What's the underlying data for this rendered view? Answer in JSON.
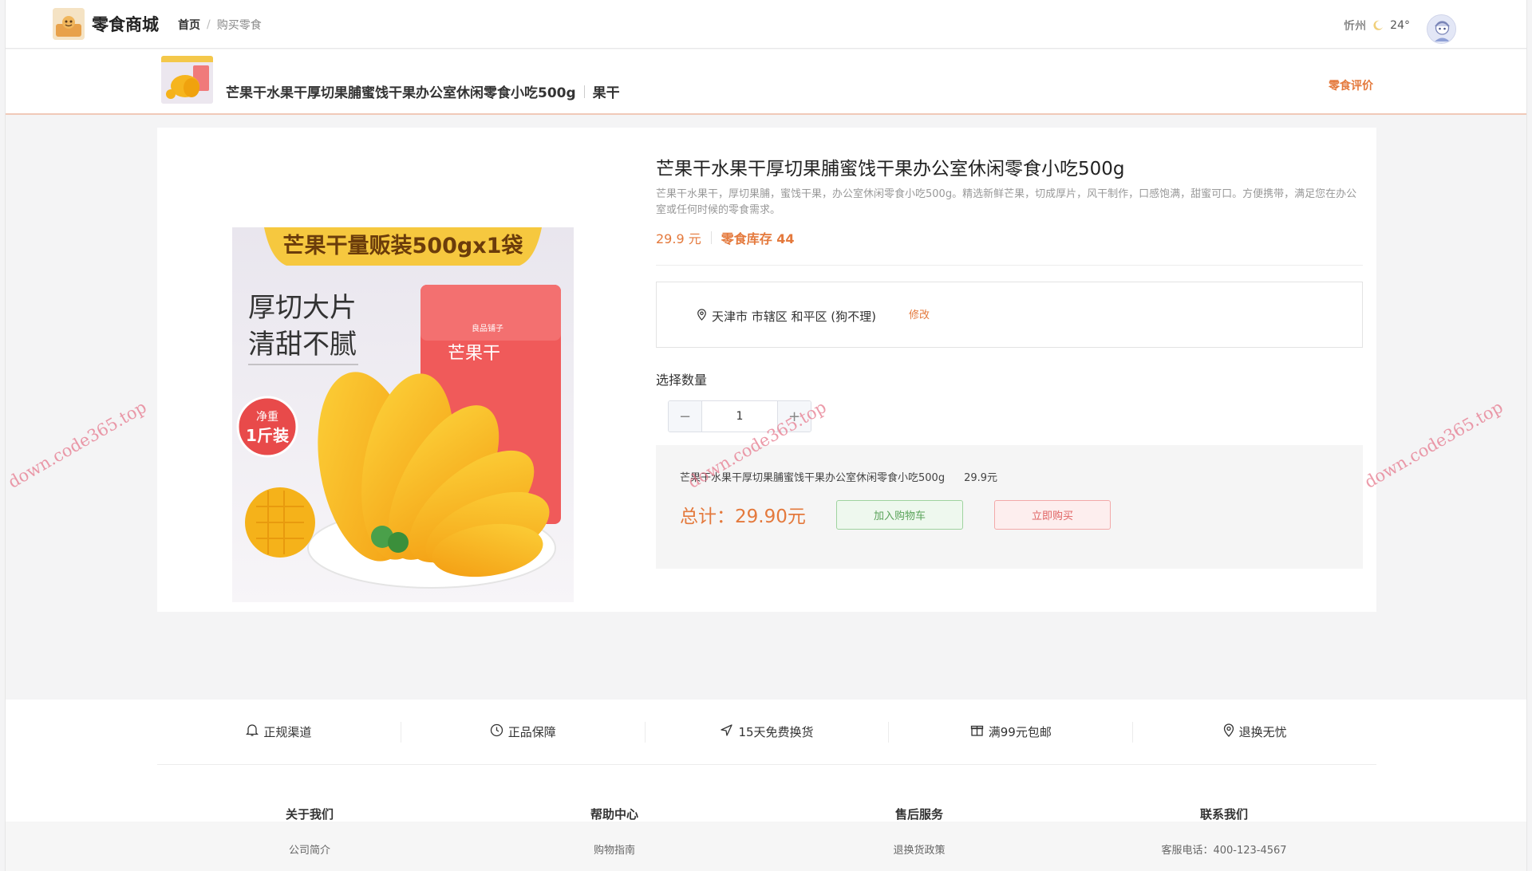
{
  "header": {
    "brand": "零食商城",
    "breadcrumb": [
      "首页",
      "/",
      "购买零食"
    ],
    "city": "忻州",
    "temperature": "24°"
  },
  "product_bar": {
    "title": "芒果干水果干厚切果脯蜜饯干果办公室休闲零食小吃500g",
    "category": "果干",
    "review_link": "零食评价",
    "thumb_banner": "芒果干量贩装500gx1袋"
  },
  "product": {
    "title": "芒果干水果干厚切果脯蜜饯干果办公室休闲零食小吃500g",
    "description": "芒果干水果干，厚切果脯，蜜饯干果，办公室休闲零食小吃500g。精选新鲜芒果，切成厚片，风干制作，口感饱满，甜蜜可口。方便携带，满足您在办公室或任何时候的零食需求。",
    "price": "29.9 元",
    "stock": "零食库存 44",
    "image_text": {
      "banner": "芒果干量贩装500gx1袋",
      "slogan1": "厚切大片",
      "slogan2": "清甜不腻",
      "badge1": "净重",
      "badge2": "1斤装",
      "pack_brand": "良品铺子",
      "pack_name": "芒果干"
    }
  },
  "address": {
    "text": "天津市 市辖区 和平区 (狗不理)",
    "modify": "修改"
  },
  "quantity": {
    "label": "选择数量",
    "value": "1",
    "minus": "−",
    "plus": "+"
  },
  "summary": {
    "item_name": "芒果干水果干厚切果脯蜜饯干果办公室休闲零食小吃500g",
    "item_price": "29.9元",
    "total": "总计：29.90元",
    "add_to_cart": "加入购物车",
    "buy_now": "立即购买"
  },
  "guarantees": [
    "正规渠道",
    "正品保障",
    "15天免费换货",
    "满99元包邮",
    "退换无忧"
  ],
  "footer_columns": [
    {
      "heading": "关于我们",
      "link": "公司简介"
    },
    {
      "heading": "帮助中心",
      "link": "购物指南"
    },
    {
      "heading": "售后服务",
      "link": "退换货政策"
    },
    {
      "heading": "联系我们",
      "link": "客服电话：400-123-4567"
    }
  ],
  "watermark": "down.code365.top",
  "colors": {
    "accent": "#e4793c",
    "cart_green": "#5aa35a",
    "buy_red": "#e06363"
  }
}
